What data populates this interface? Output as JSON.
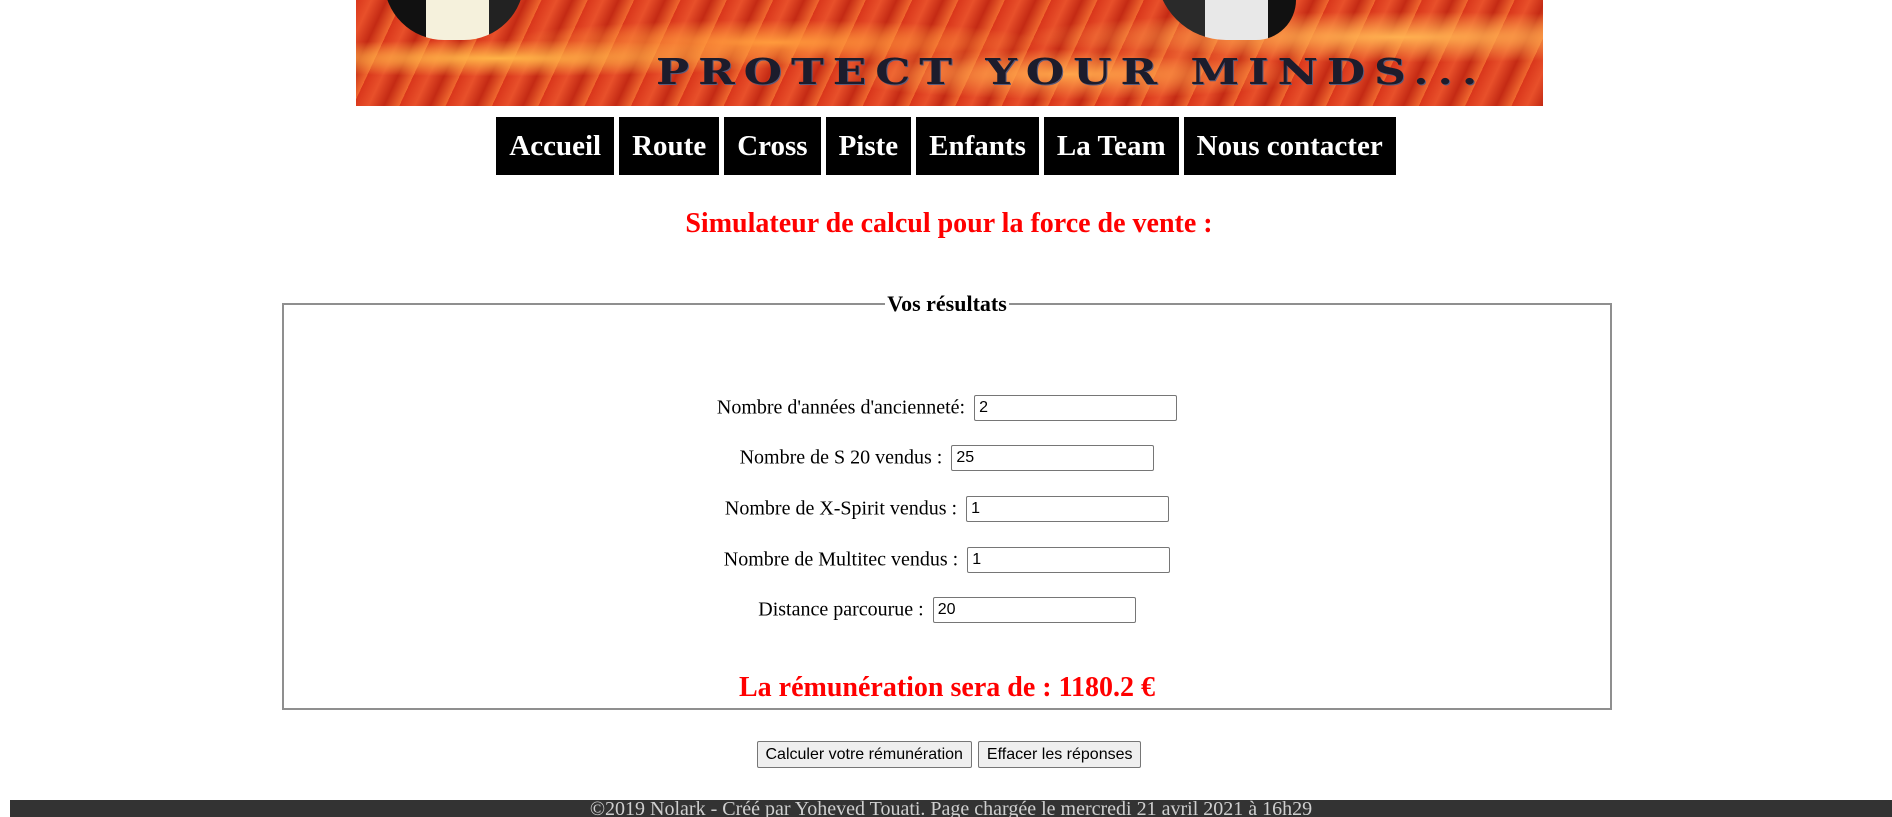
{
  "banner": {
    "slogan": "PROTECT YOUR MINDS..."
  },
  "nav": {
    "items": [
      {
        "label": "Accueil"
      },
      {
        "label": "Route"
      },
      {
        "label": "Cross"
      },
      {
        "label": "Piste"
      },
      {
        "label": "Enfants"
      },
      {
        "label": "La Team"
      },
      {
        "label": "Nous contacter"
      }
    ]
  },
  "page": {
    "heading": "Simulateur de calcul pour la force de vente :"
  },
  "results": {
    "legend": "Vos résultats",
    "fields": [
      {
        "label": "Nombre d'années d'ancienneté:",
        "value": "2"
      },
      {
        "label": "Nombre de S 20 vendus :",
        "value": "25"
      },
      {
        "label": "Nombre de X-Spirit vendus :",
        "value": "1"
      },
      {
        "label": "Nombre de Multitec vendus :",
        "value": "1"
      },
      {
        "label": "Distance parcourue :",
        "value": "20"
      }
    ],
    "result_text": "La rémunération sera de : 1180.2 €"
  },
  "actions": {
    "calculate_label": "Calculer votre rémunération",
    "reset_label": "Effacer les réponses"
  },
  "footer": {
    "text": "©2019 Nolark - Créé par Yoheved Touati. Page chargée le mercredi 21 avril 2021 à 16h29"
  },
  "colors": {
    "accent": "#ff0000",
    "nav_background": "#000000",
    "footer_background": "#333333"
  }
}
